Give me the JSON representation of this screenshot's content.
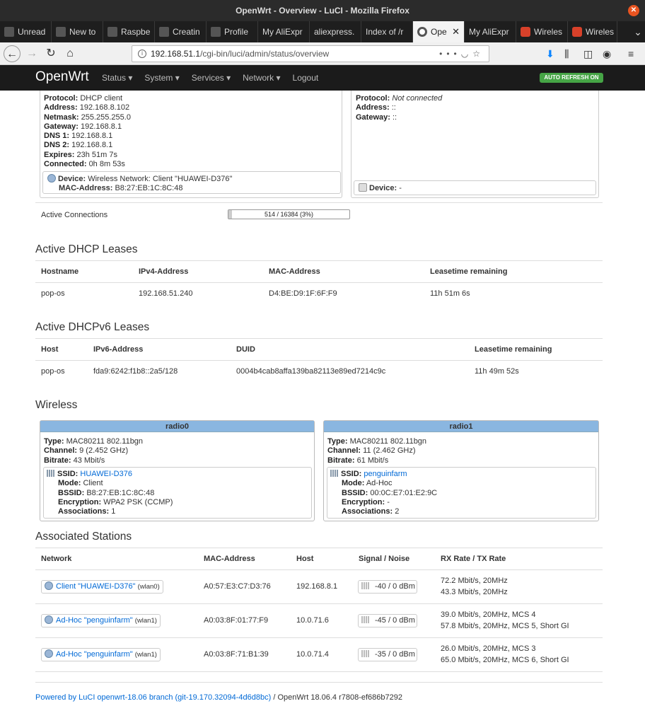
{
  "window": {
    "title": "OpenWrt - Overview - LuCI - Mozilla Firefox"
  },
  "tabs": [
    {
      "label": "Unread",
      "icon": "openwrt-forum-icon",
      "active": false
    },
    {
      "label": "New to",
      "icon": "openwrt-forum-icon",
      "active": false
    },
    {
      "label": "Raspbe",
      "icon": "openwrt-forum-icon",
      "active": false
    },
    {
      "label": "Creatin",
      "icon": "openwrt-forum-icon",
      "active": false
    },
    {
      "label": "Profile",
      "icon": "openwrt-forum-icon",
      "active": false
    },
    {
      "label": "My AliExpr",
      "icon": "",
      "active": false
    },
    {
      "label": "aliexpress.",
      "icon": "",
      "active": false
    },
    {
      "label": "Index of /r",
      "icon": "",
      "active": false
    },
    {
      "label": "Ope",
      "icon": "openwrt-icon",
      "active": true
    },
    {
      "label": "My AliExpr",
      "icon": "",
      "active": false
    },
    {
      "label": "Wireles",
      "icon": "brave-icon",
      "active": false
    },
    {
      "label": "Wireles",
      "icon": "brave-icon",
      "active": false
    }
  ],
  "urlbar": {
    "host": "192.168.51.1",
    "path": "/cgi-bin/luci/admin/status/overview"
  },
  "header": {
    "brand": "OpenWrt",
    "menu": [
      "Status",
      "System",
      "Services",
      "Network",
      "Logout"
    ],
    "autorefresh": "AUTO REFRESH ON"
  },
  "ipv4": {
    "protocol_label": "Protocol:",
    "protocol": "DHCP client",
    "address_label": "Address:",
    "address": "192.168.8.102",
    "netmask_label": "Netmask:",
    "netmask": "255.255.255.0",
    "gateway_label": "Gateway:",
    "gateway": "192.168.8.1",
    "dns1_label": "DNS 1:",
    "dns1": "192.168.8.1",
    "dns2_label": "DNS 2:",
    "dns2": "192.168.8.1",
    "expires_label": "Expires:",
    "expires": "23h 51m 7s",
    "connected_label": "Connected:",
    "connected": "0h 8m 53s",
    "device_label": "Device:",
    "device": "Wireless Network: Client \"HUAWEI-D376\"",
    "mac_label": "MAC-Address:",
    "mac": "B8:27:EB:1C:8C:48"
  },
  "ipv6": {
    "protocol_label": "Protocol:",
    "protocol": "Not connected",
    "address_label": "Address:",
    "address": "::",
    "gateway_label": "Gateway:",
    "gateway": "::",
    "device_label": "Device:",
    "device": "-"
  },
  "connections": {
    "label": "Active Connections",
    "text": "514 / 16384 (3%)",
    "fraction": 0.03
  },
  "dhcp": {
    "title": "Active DHCP Leases",
    "headers": [
      "Hostname",
      "IPv4-Address",
      "MAC-Address",
      "Leasetime remaining"
    ],
    "rows": [
      [
        "pop-os",
        "192.168.51.240",
        "D4:BE:D9:1F:6F:F9",
        "11h 51m 6s"
      ]
    ]
  },
  "dhcpv6": {
    "title": "Active DHCPv6 Leases",
    "headers": [
      "Host",
      "IPv6-Address",
      "DUID",
      "Leasetime remaining"
    ],
    "rows": [
      [
        "pop-os",
        "fda9:6242:f1b8::2a5/128",
        "0004b4cab8affa139ba82113e89ed7214c9c",
        "11h 49m 52s"
      ]
    ]
  },
  "wireless": {
    "title": "Wireless",
    "radios": [
      {
        "name": "radio0",
        "type_label": "Type:",
        "type": "MAC80211 802.11bgn",
        "channel_label": "Channel:",
        "channel": "9 (2.452 GHz)",
        "bitrate_label": "Bitrate:",
        "bitrate": "43 Mbit/s",
        "ssid_label": "SSID:",
        "ssid": "HUAWEI-D376",
        "mode_label": "Mode:",
        "mode": "Client",
        "bssid_label": "BSSID:",
        "bssid": "B8:27:EB:1C:8C:48",
        "enc_label": "Encryption:",
        "encryption": "WPA2 PSK (CCMP)",
        "assoc_label": "Associations:",
        "associations": "1"
      },
      {
        "name": "radio1",
        "type_label": "Type:",
        "type": "MAC80211 802.11bgn",
        "channel_label": "Channel:",
        "channel": "11 (2.462 GHz)",
        "bitrate_label": "Bitrate:",
        "bitrate": "61 Mbit/s",
        "ssid_label": "SSID:",
        "ssid": "penguinfarm",
        "mode_label": "Mode:",
        "mode": "Ad-Hoc",
        "bssid_label": "BSSID:",
        "bssid": "00:0C:E7:01:E2:9C",
        "enc_label": "Encryption:",
        "encryption": "-",
        "assoc_label": "Associations:",
        "associations": "2"
      }
    ]
  },
  "stations": {
    "title": "Associated Stations",
    "headers": [
      "Network",
      "MAC-Address",
      "Host",
      "Signal / Noise",
      "RX Rate / TX Rate"
    ],
    "rows": [
      {
        "network": "Client \"HUAWEI-D376\"",
        "iface": "(wlan0)",
        "mac": "A0:57:E3:C7:D3:76",
        "host": "192.168.8.1",
        "signal": "-40 / 0 dBm",
        "rx": "72.2 Mbit/s, 20MHz",
        "tx": "43.3 Mbit/s, 20MHz"
      },
      {
        "network": "Ad-Hoc \"penguinfarm\"",
        "iface": "(wlan1)",
        "mac": "A0:03:8F:01:77:F9",
        "host": "10.0.71.6",
        "signal": "-45 / 0 dBm",
        "rx": "39.0 Mbit/s, 20MHz, MCS 4",
        "tx": "57.8 Mbit/s, 20MHz, MCS 5, Short GI"
      },
      {
        "network": "Ad-Hoc \"penguinfarm\"",
        "iface": "(wlan1)",
        "mac": "A0:03:8F:71:B1:39",
        "host": "10.0.71.4",
        "signal": "-35 / 0 dBm",
        "rx": "26.0 Mbit/s, 20MHz, MCS 3",
        "tx": "65.0 Mbit/s, 20MHz, MCS 6, Short GI"
      }
    ]
  },
  "footer": {
    "link": "Powered by LuCI openwrt-18.06 branch (git-19.170.32094-4d6d8bc)",
    "sep": " / ",
    "version": "OpenWrt 18.06.4 r7808-ef686b7292"
  },
  "colors": {
    "header_bg": "#1b1b1b",
    "radio_header": "#8ab6e0",
    "link": "#0069d6",
    "autorefresh": "#46a546"
  }
}
